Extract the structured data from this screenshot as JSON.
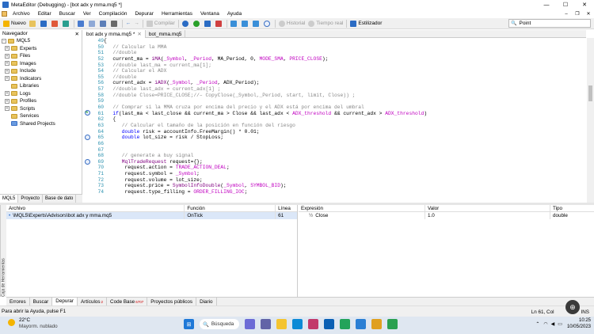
{
  "window": {
    "title": "MetaEditor (Debugging) - [bot adx y mma.mq5 *]",
    "controls": [
      "—",
      "☐",
      "✕"
    ]
  },
  "menu": {
    "items": [
      "Archivo",
      "Editar",
      "Buscar",
      "Ver",
      "Compilación",
      "Depurar",
      "Herramientas",
      "Ventana",
      "Ayuda"
    ]
  },
  "toolbar": {
    "new_label": "Nuevo",
    "compile_label": "Compilar",
    "history_label": "Historial",
    "remote_time_label": "Tiempo real",
    "styler_label": "Estilizador",
    "search_value": "Point"
  },
  "navigator": {
    "title": "Navegador",
    "root": "MQL5",
    "items": [
      "Experts",
      "Files",
      "Images",
      "Include",
      "Indicators",
      "Libraries",
      "Logs",
      "Profiles",
      "Scripts",
      "Services",
      "Shared Projects"
    ],
    "tabs": [
      "MQL5",
      "Proyecto",
      "Base de dato"
    ]
  },
  "editor": {
    "tabs": [
      "bot adx y mma.mq5 *",
      "bot_mma.mq5"
    ],
    "lines": [
      {
        "n": "49",
        "t": "{"
      },
      {
        "n": "50",
        "t": "   // Calcular la MMA"
      },
      {
        "n": "51",
        "t": "   //double"
      },
      {
        "n": "52",
        "t": "   current_ma = iMA(_Symbol, _Period, MA_Period, 0, MODE_SMA, PRICE_CLOSE);"
      },
      {
        "n": "53",
        "t": "   //double last_ma = current_ma[1];"
      },
      {
        "n": "54",
        "t": "   // Calcular el ADX"
      },
      {
        "n": "55",
        "t": "   //double"
      },
      {
        "n": "56",
        "t": "   current_adx = iADX(_Symbol, _Period, ADX_Period);"
      },
      {
        "n": "57",
        "t": "   //double last_adx = current_adx[1] ;"
      },
      {
        "n": "58",
        "t": "   //double Close=PRICE_CLOSE;//– CopyClose(_Symbol,_Period, start, limit, Close)) ;"
      },
      {
        "n": "59",
        "t": ""
      },
      {
        "n": "60",
        "t": "   // Comprar si la MMA cruza por encima del precio y el ADX está por encima del umbral"
      },
      {
        "n": "61",
        "t": "   if(last_ma < last_close && current_ma > Close && last_adx < ADX_threshold && current_adx > ADX_threshold)"
      },
      {
        "n": "62",
        "t": "   {"
      },
      {
        "n": "63",
        "t": "      // Calcular el tamaño de la posición en función del riesgo"
      },
      {
        "n": "64",
        "t": "      double risk = accountInfo.FreeMargin() * 0.01;"
      },
      {
        "n": "65",
        "t": "      double lot_size = risk / StopLoss;"
      },
      {
        "n": "66",
        "t": ""
      },
      {
        "n": "67",
        "t": ""
      },
      {
        "n": "68",
        "t": "      // generate a buy signal"
      },
      {
        "n": "69",
        "t": "      MqlTradeRequest request={};"
      },
      {
        "n": "70",
        "t": "       request.action = TRADE_ACTION_DEAL;"
      },
      {
        "n": "71",
        "t": "       request.symbol = _Symbol;"
      },
      {
        "n": "72",
        "t": "       request.volume = lot_size;"
      },
      {
        "n": "73",
        "t": "       request.price = SymbolInfoDouble(_Symbol, SYMBOL_BID);"
      },
      {
        "n": "74",
        "t": "       request.type_filling = ORDER_FILLING_IOC;"
      }
    ]
  },
  "callstack": {
    "headers": [
      "Archivo",
      "Función",
      "Línea"
    ],
    "rows": [
      {
        "file": "\\MQL5\\Experts\\Advisors\\bot adx y mma.mq5",
        "func": "OnTick",
        "line": "61"
      }
    ]
  },
  "watch": {
    "headers": [
      "Expresión",
      "Valor",
      "Tipo"
    ],
    "rows": [
      {
        "expr": "Close",
        "value": "1.0",
        "type": "double"
      }
    ]
  },
  "side_toolbox": "Caja de Herramientas",
  "bottom_tabs": {
    "items": [
      "Errores",
      "Buscar",
      "Depurar",
      "Artículos",
      "Code Base",
      "Proyectos públicos",
      "Diario"
    ],
    "articles_badge": "2",
    "codebase_badge": "6707"
  },
  "status": {
    "left": "Para abrir la Ayuda, pulse F1",
    "position": "Ln 61, Col",
    "mode": "INS"
  },
  "taskbar": {
    "temperature": "22°C",
    "weather": "Mayorm. nublado",
    "search_label": "Búsqueda",
    "time": "10:25",
    "date": "10/05/2023"
  },
  "colors": {
    "accent": "#2b6cc4",
    "comment": "#888888",
    "keyword": "#0000ff",
    "breakpoint": "#3a6fc4",
    "current_line_arrow": "#2aa02a"
  }
}
